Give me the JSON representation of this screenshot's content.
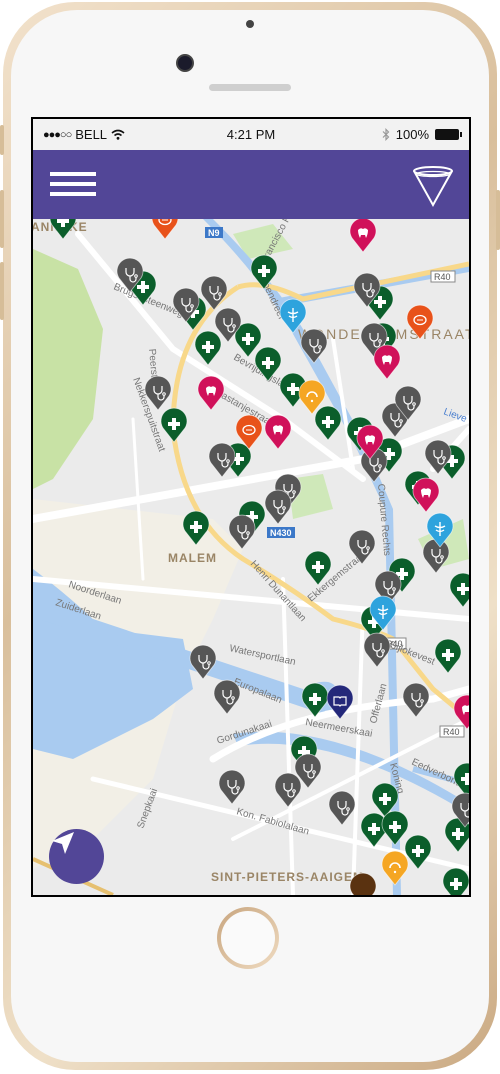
{
  "status_bar": {
    "signal": "●●●○○",
    "carrier": "BELL",
    "time": "4:21 PM",
    "battery": "100%"
  },
  "header": {
    "menu_icon": "hamburger-menu-icon",
    "filter_icon": "funnel-filter-icon",
    "background": "#524697"
  },
  "map": {
    "labels": {
      "district_ne": "WONDELGEMSTRAAT",
      "district_nw": "ANNEKE",
      "malem": "MALEM",
      "sint_pieters": "SINT-PIETERS-AAIGEM",
      "n9": "N9",
      "n430": "N430",
      "r40_a": "R40",
      "r40_b": "R40",
      "r40_c": "R40",
      "brugsesteenweg": "Brugsesteenweg",
      "groendreef": "Groendreef",
      "francisco": "Francisco Ferrerlaan",
      "peerstraat": "Peerstraat",
      "nekkerspoel": "Nekkerspuitstraat",
      "kastanjestraat": "Kastanjestraat",
      "bevrijdingslaan": "Bevrijdingslaan",
      "noorderlaan": "Noorderlaan",
      "zuiderlaan": "Zuiderlaan",
      "watersportlaan": "Watersportlaan",
      "henri": "Henri Dunantlaan",
      "ekkergem": "Ekkergemstraat",
      "europalaan": "Europalaan",
      "gordunakaai": "Gordunakaai",
      "neermeerskaai": "Neermeerskaai",
      "offerlaan": "Offerlaan",
      "bijlokevest": "Bijlokevest",
      "fabiolalaan": "Kon. Fabiolalaan",
      "snepkaai": "Snepkaai",
      "eedverbond": "Eedverbondkaai",
      "coupure": "Coupure Rechts",
      "koning": "Koning",
      "lieve": "Lieve"
    },
    "marker_types": {
      "pharmacy": {
        "icon": "plus-icon",
        "color": "#0b5e2b"
      },
      "doctor": {
        "icon": "stethoscope-icon",
        "color": "#565656"
      },
      "dentist": {
        "icon": "tooth-icon",
        "color": "#d0115a"
      },
      "chat": {
        "icon": "speech-bubble-icon",
        "color": "#e8521a"
      },
      "hospital": {
        "icon": "caduceus-icon",
        "color": "#2ea3dd"
      },
      "helpdesk": {
        "icon": "headset-icon",
        "color": "#f5a623"
      },
      "library": {
        "icon": "book-icon",
        "color": "#24287a"
      },
      "other": {
        "icon": "pin-icon",
        "color": "#5a3210"
      }
    },
    "locate_icon": "navigation-arrow-icon"
  }
}
